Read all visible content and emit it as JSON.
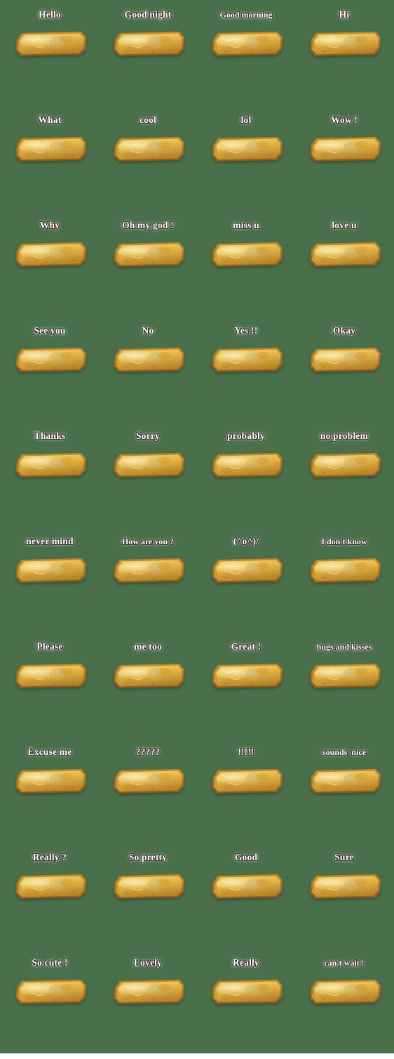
{
  "sheet": {
    "background_color": "#4a704b",
    "columns": 4,
    "rows": 10,
    "caption_color": "#ffffff",
    "caption_outline_color": "#3a3330",
    "sticker_name": "toast-bread-slice"
  },
  "palette": {
    "crust_dark": "#8a5a1e",
    "crust_mid": "#c08a2c",
    "toast_golden": "#e7b84a",
    "toast_light": "#f2d87a",
    "toast_highlight": "#f7eab0",
    "toast_shadow": "#b9862a",
    "butter_spot": "#c9b26a"
  },
  "stickers": [
    {
      "caption": "Hello"
    },
    {
      "caption": "Good night"
    },
    {
      "caption": "Good morning"
    },
    {
      "caption": "Hi"
    },
    {
      "caption": "What"
    },
    {
      "caption": "cool"
    },
    {
      "caption": "lol"
    },
    {
      "caption": "Wow !"
    },
    {
      "caption": "Why"
    },
    {
      "caption": "Oh my god !"
    },
    {
      "caption": "miss u"
    },
    {
      "caption": "love u"
    },
    {
      "caption": "See you"
    },
    {
      "caption": "No"
    },
    {
      "caption": "Yes !!"
    },
    {
      "caption": "Okay"
    },
    {
      "caption": "Thanks"
    },
    {
      "caption": "Sorry"
    },
    {
      "caption": "probably"
    },
    {
      "caption": "no problem"
    },
    {
      "caption": "never mind"
    },
    {
      "caption": "How are you ?"
    },
    {
      "caption": "(^o^)/"
    },
    {
      "caption": "I don't know"
    },
    {
      "caption": "Please"
    },
    {
      "caption": "me too"
    },
    {
      "caption": "Great !"
    },
    {
      "caption": "hugs and kisses"
    },
    {
      "caption": "Excuse me"
    },
    {
      "caption": "?????"
    },
    {
      "caption": "!!!!!"
    },
    {
      "caption": "sounds  nice"
    },
    {
      "caption": "Really ?"
    },
    {
      "caption": "So pretty"
    },
    {
      "caption": "Good"
    },
    {
      "caption": "Sure"
    },
    {
      "caption": "So cute !"
    },
    {
      "caption": "Lovely"
    },
    {
      "caption": "Really"
    },
    {
      "caption": "can't wait !"
    }
  ]
}
